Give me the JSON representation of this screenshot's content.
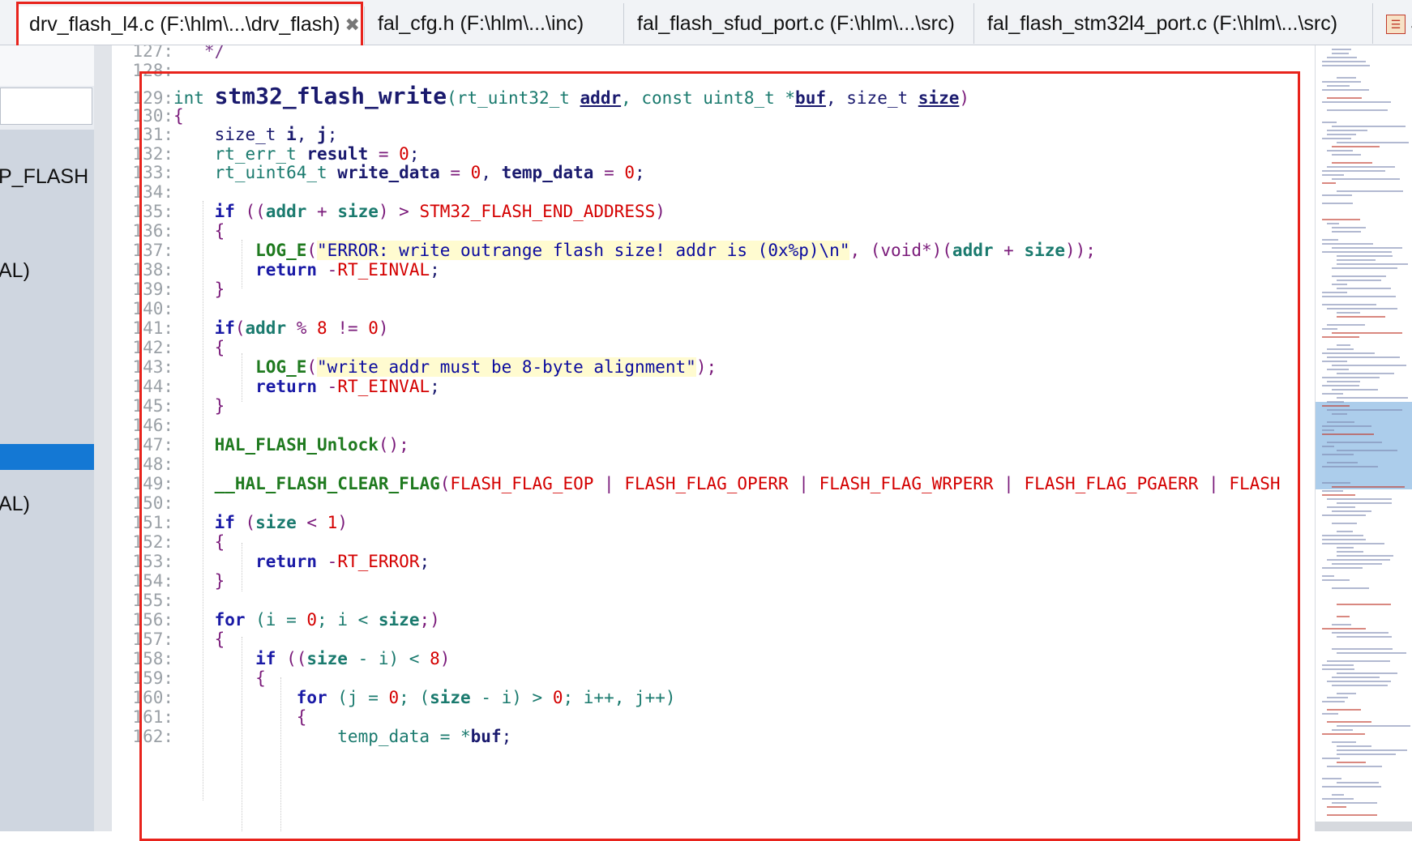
{
  "tabs": [
    {
      "label": "drv_flash_l4.c (F:\\hlm\\...\\drv_flash)",
      "active": true,
      "close_icon": "✖"
    },
    {
      "label": "fal_cfg.h (F:\\hlm\\...\\inc)"
    },
    {
      "label": "fal_flash_sfud_port.c (F:\\hlm\\...\\src)"
    },
    {
      "label": "fal_flash_stm32l4_port.c (F:\\hlm\\...\\src)"
    },
    {
      "label": "S",
      "icon": "app-icon"
    }
  ],
  "side_tree": [
    "P_FLASH",
    "AL)",
    "AL)"
  ],
  "colors": {
    "highlight": "#e8231c",
    "selection": "#1478d4"
  },
  "code": {
    "l127": {
      "n": "127:",
      "t": "   */"
    },
    "l128": {
      "n": "128:",
      "t": ""
    },
    "l129": {
      "n": "129:",
      "a": "int ",
      "b": "stm32_flash_write",
      "c": "(rt_uint32_t ",
      "d": "addr",
      "e": ", const uint8_t *",
      "f": "buf",
      "g": ", size_t ",
      "h": "size",
      "i": ")"
    },
    "l130": {
      "n": "130:",
      "t": "{"
    },
    "l131": {
      "n": "131:",
      "a": "    size_t ",
      "b": "i",
      "c": ", ",
      "d": "j",
      "e": ";"
    },
    "l132": {
      "n": "132:",
      "a": "    rt_err_t ",
      "b": "result",
      "c": " = ",
      "d": "0",
      "e": ";"
    },
    "l133": {
      "n": "133:",
      "a": "    rt_uint64_t ",
      "b": "write_data",
      "c": " = ",
      "d": "0",
      "e": ", ",
      "f": "temp_data",
      "g": " = ",
      "h": "0",
      "i": ";"
    },
    "l134": {
      "n": "134:",
      "t": ""
    },
    "l135": {
      "n": "135:",
      "a": "    if",
      "b": " ((",
      "c": "addr",
      "d": " + ",
      "e": "size",
      "f": ") > ",
      "g": "STM32_FLASH_END_ADDRESS",
      "h": ")"
    },
    "l136": {
      "n": "136:",
      "t": "    {"
    },
    "l137": {
      "n": "137:",
      "a": "        ",
      "b": "LOG_E",
      "c": "(",
      "d": "\"ERROR: write outrange flash size! addr is (0x%p)\\n\"",
      "e": ", (void*)(",
      "f": "addr",
      "g": " + ",
      "h": "size",
      "i": "));"
    },
    "l138": {
      "n": "138:",
      "a": "        return",
      "b": " -",
      "c": "RT_EINVAL",
      "d": ";"
    },
    "l139": {
      "n": "139:",
      "t": "    }"
    },
    "l140": {
      "n": "140:",
      "t": ""
    },
    "l141": {
      "n": "141:",
      "a": "    if",
      "b": "(",
      "c": "addr",
      "d": " % ",
      "e": "8",
      "f": " != ",
      "g": "0",
      "h": ")"
    },
    "l142": {
      "n": "142:",
      "t": "    {"
    },
    "l143": {
      "n": "143:",
      "a": "        ",
      "b": "LOG_E",
      "c": "(",
      "d": "\"write addr must be 8-byte alignment\"",
      "e": ");"
    },
    "l144": {
      "n": "144:",
      "a": "        return",
      "b": " -",
      "c": "RT_EINVAL",
      "d": ";"
    },
    "l145": {
      "n": "145:",
      "t": "    }"
    },
    "l146": {
      "n": "146:",
      "t": ""
    },
    "l147": {
      "n": "147:",
      "a": "    ",
      "b": "HAL_FLASH_Unlock",
      "c": "();"
    },
    "l148": {
      "n": "148:",
      "t": ""
    },
    "l149": {
      "n": "149:",
      "a": "    ",
      "b": "__HAL_FLASH_CLEAR_FLAG",
      "c": "(",
      "d": "FLASH_FLAG_EOP",
      "e": " | ",
      "f": "FLASH_FLAG_OPERR",
      "g": " | ",
      "h": "FLASH_FLAG_WRPERR",
      "i": " | ",
      "j": "FLASH_FLAG_PGAERR",
      "k": " | ",
      "l": "FLASH"
    },
    "l150": {
      "n": "150:",
      "t": ""
    },
    "l151": {
      "n": "151:",
      "a": "    if",
      "b": " (",
      "c": "size",
      "d": " < ",
      "e": "1",
      "f": ")"
    },
    "l152": {
      "n": "152:",
      "t": "    {"
    },
    "l153": {
      "n": "153:",
      "a": "        return",
      "b": " -",
      "c": "RT_ERROR",
      "d": ";"
    },
    "l154": {
      "n": "154:",
      "t": "    }"
    },
    "l155": {
      "n": "155:",
      "t": ""
    },
    "l156": {
      "n": "156:",
      "a": "    for",
      "b": " (i = ",
      "c": "0",
      "d": "; i < ",
      "e": "size",
      "f": ";)"
    },
    "l157": {
      "n": "157:",
      "t": "    {"
    },
    "l158": {
      "n": "158:",
      "a": "        if",
      "b": " ((",
      "c": "size",
      "d": " - i) < ",
      "e": "8",
      "f": ")"
    },
    "l159": {
      "n": "159:",
      "t": "        {"
    },
    "l160": {
      "n": "160:",
      "a": "            for",
      "b": " (j = ",
      "c": "0",
      "d": "; (",
      "e": "size",
      "f": " - i) > ",
      "g": "0",
      "h": "; i++, j++)"
    },
    "l161": {
      "n": "161:",
      "t": "            {"
    },
    "l162": {
      "n": "162:",
      "a": "                temp_data = *",
      "b": "buf",
      "c": ";"
    }
  }
}
